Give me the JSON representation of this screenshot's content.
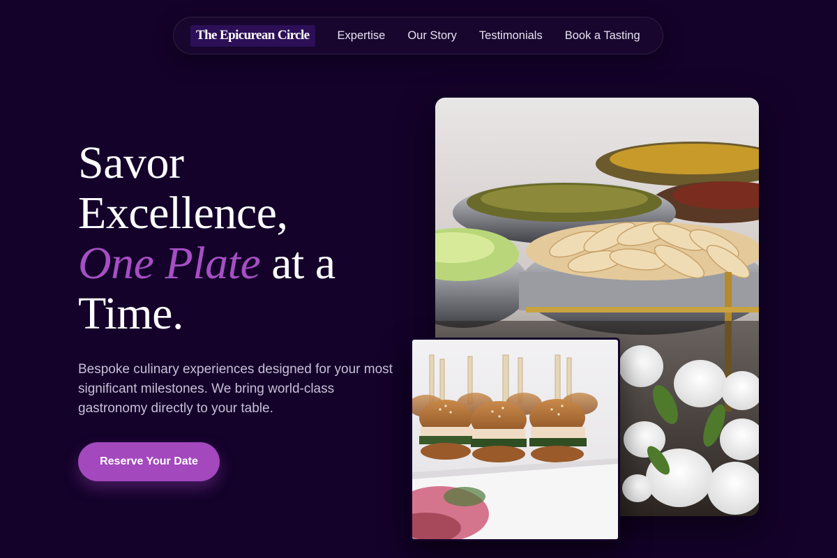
{
  "nav": {
    "brand": "The Epicurean Circle",
    "links": [
      "Expertise",
      "Our Story",
      "Testimonials",
      "Book a Tasting"
    ]
  },
  "hero": {
    "headline_line1": "Savor",
    "headline_line2": "Excellence,",
    "headline_accent": "One Plate",
    "headline_line3_rest": " at a",
    "headline_line4": "Time.",
    "description": "Bespoke culinary experiences designed for your most significant milestones. We bring world-class gastronomy directly to your table.",
    "cta_label": "Reserve Your Date"
  },
  "images": {
    "large": "catering-buffet-photo",
    "small": "sliders-appetizer-photo"
  },
  "colors": {
    "background": "#14022a",
    "accent": "#a64fc4",
    "button": "#a348bd",
    "brand_bg": "#2c0f57"
  }
}
